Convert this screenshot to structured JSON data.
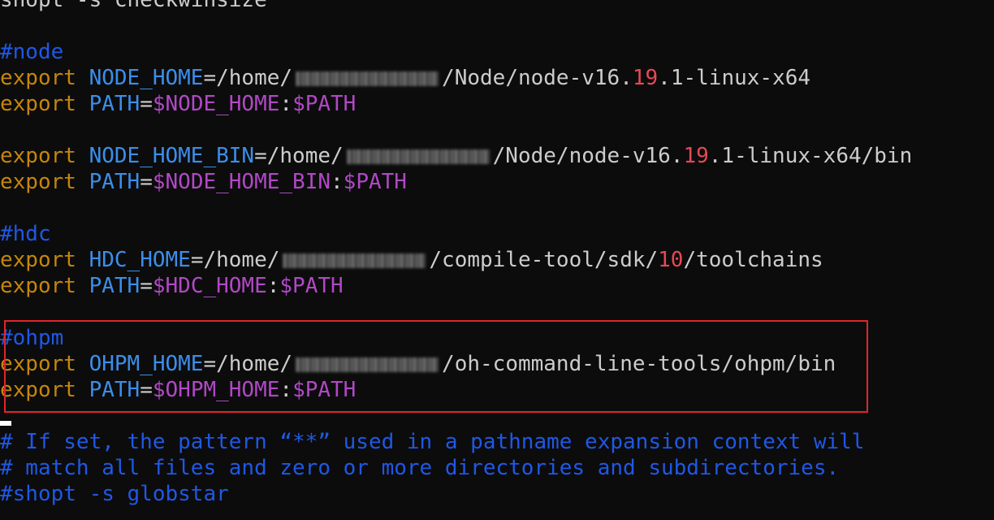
{
  "terminal": {
    "lines": [
      {
        "tokens": [
          {
            "t": "shopt -s checkwinsize",
            "c": "white"
          }
        ]
      },
      {
        "tokens": []
      },
      {
        "tokens": [
          {
            "t": "#node",
            "c": "comment"
          }
        ]
      },
      {
        "tokens": [
          {
            "t": "export ",
            "c": "kw"
          },
          {
            "t": "NODE_HOME",
            "c": "var"
          },
          {
            "t": "=/home/",
            "c": "white"
          },
          {
            "t": "[redacted]",
            "c": "redacted"
          },
          {
            "t": "/Node/node-v16.",
            "c": "white"
          },
          {
            "t": "19",
            "c": "num"
          },
          {
            "t": ".1-linux-x64",
            "c": "white"
          }
        ]
      },
      {
        "tokens": [
          {
            "t": "export ",
            "c": "kw"
          },
          {
            "t": "PATH",
            "c": "var"
          },
          {
            "t": "=",
            "c": "white"
          },
          {
            "t": "$NODE_HOME",
            "c": "ref"
          },
          {
            "t": ":",
            "c": "white"
          },
          {
            "t": "$PATH",
            "c": "ref"
          }
        ]
      },
      {
        "tokens": []
      },
      {
        "tokens": [
          {
            "t": "export ",
            "c": "kw"
          },
          {
            "t": "NODE_HOME_BIN",
            "c": "var"
          },
          {
            "t": "=/home/",
            "c": "white"
          },
          {
            "t": "[redacted]",
            "c": "redacted"
          },
          {
            "t": "/Node/node-v16.",
            "c": "white"
          },
          {
            "t": "19",
            "c": "num"
          },
          {
            "t": ".1-linux-x64/bin",
            "c": "white"
          }
        ]
      },
      {
        "tokens": [
          {
            "t": "export ",
            "c": "kw"
          },
          {
            "t": "PATH",
            "c": "var"
          },
          {
            "t": "=",
            "c": "white"
          },
          {
            "t": "$NODE_HOME_BIN",
            "c": "ref"
          },
          {
            "t": ":",
            "c": "white"
          },
          {
            "t": "$PATH",
            "c": "ref"
          }
        ]
      },
      {
        "tokens": []
      },
      {
        "tokens": [
          {
            "t": "#hdc",
            "c": "comment"
          }
        ]
      },
      {
        "tokens": [
          {
            "t": "export ",
            "c": "kw"
          },
          {
            "t": "HDC_HOME",
            "c": "var"
          },
          {
            "t": "=/home/",
            "c": "white"
          },
          {
            "t": "[redacted]",
            "c": "redacted"
          },
          {
            "t": "/compile-tool/sdk/",
            "c": "white"
          },
          {
            "t": "10",
            "c": "num"
          },
          {
            "t": "/toolchains",
            "c": "white"
          }
        ]
      },
      {
        "tokens": [
          {
            "t": "export ",
            "c": "kw"
          },
          {
            "t": "PATH",
            "c": "var"
          },
          {
            "t": "=",
            "c": "white"
          },
          {
            "t": "$HDC_HOME",
            "c": "ref"
          },
          {
            "t": ":",
            "c": "white"
          },
          {
            "t": "$PATH",
            "c": "ref"
          }
        ]
      },
      {
        "tokens": []
      },
      {
        "tokens": [
          {
            "t": "#ohpm",
            "c": "comment"
          }
        ]
      },
      {
        "tokens": [
          {
            "t": "export ",
            "c": "kw"
          },
          {
            "t": "OHPM_HOME",
            "c": "var"
          },
          {
            "t": "=/home/",
            "c": "white"
          },
          {
            "t": "[redacted]",
            "c": "redacted"
          },
          {
            "t": "/oh-command-line-tools/ohpm/bin",
            "c": "white"
          }
        ]
      },
      {
        "tokens": [
          {
            "t": "export ",
            "c": "kw"
          },
          {
            "t": "PATH",
            "c": "var"
          },
          {
            "t": "=",
            "c": "white"
          },
          {
            "t": "$OHPM_HOME",
            "c": "ref"
          },
          {
            "t": ":",
            "c": "white"
          },
          {
            "t": "$PATH",
            "c": "ref"
          }
        ]
      },
      {
        "tokens": []
      },
      {
        "tokens": [
          {
            "t": "# If set, the pattern “**” used in a pathname expansion context will",
            "c": "comment"
          }
        ]
      },
      {
        "tokens": [
          {
            "t": "# match all files and zero or more directories and subdirectories.",
            "c": "comment"
          }
        ]
      },
      {
        "tokens": [
          {
            "t": "#shopt -s globstar",
            "c": "comment"
          }
        ]
      }
    ]
  },
  "annotation": {
    "highlight_color": "#e3242b",
    "highlighted_section": "ohpm"
  },
  "colors": {
    "background": "#0c0c0c",
    "keyword": "#c5860a",
    "variable": "#3b8eea",
    "reference": "#b148c6",
    "number": "#e74856",
    "comment": "#1f58e6",
    "text": "#cccccc"
  }
}
